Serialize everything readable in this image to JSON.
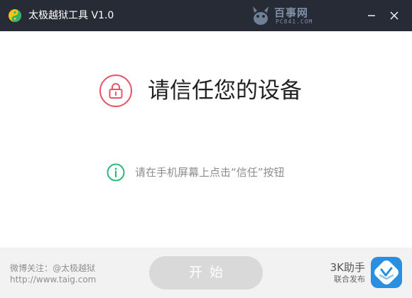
{
  "window": {
    "title": "太极越狱工具 V1.0",
    "watermark": {
      "text": "百事网",
      "sub": "PC841.COM"
    },
    "controls": {
      "minimize_icon": "minimize-icon",
      "close_icon": "close-icon"
    }
  },
  "main": {
    "heading": "请信任您的设备",
    "lock_icon": "lock-icon",
    "hint_icon": "info-icon",
    "hint": "请在手机屏幕上点击“信任”按钮"
  },
  "footer": {
    "weibo": "微博关注：@太极越狱",
    "website": "http://www.taig.com",
    "start_label": "开始",
    "brand_name": "3K助手",
    "brand_sub": "联合发布"
  },
  "colors": {
    "titlebar": "#262b36",
    "lock_accent": "#e8556a",
    "info_accent": "#2db87d",
    "start_button": "#d9d9d9",
    "brand_blue": "#2a8fe0"
  }
}
